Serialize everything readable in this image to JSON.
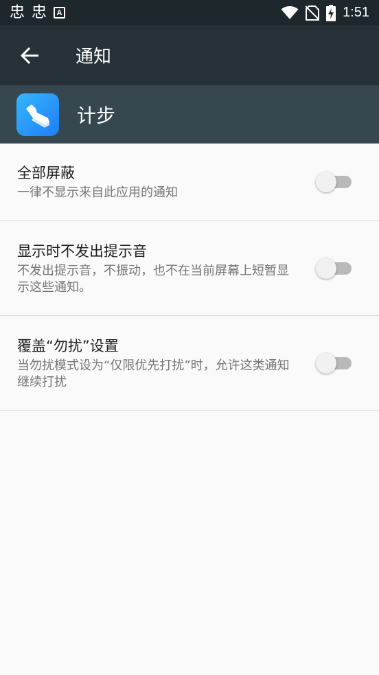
{
  "status_bar": {
    "time": "1:51",
    "left_glyphs": [
      "忠",
      "忠"
    ],
    "notification_badge": "A",
    "icons": [
      "wifi-icon",
      "no-sim-icon",
      "battery-charging-icon"
    ]
  },
  "toolbar": {
    "title": "通知",
    "back_icon": "arrow-back-icon"
  },
  "app": {
    "name": "计步",
    "icon": "shoe-icon",
    "icon_colors": [
      "#35b6ff",
      "#1f7ef5"
    ]
  },
  "settings": [
    {
      "title": "全部屏蔽",
      "description": "一律不显示来自此应用的通知",
      "enabled": false
    },
    {
      "title": "显示时不发出提示音",
      "description": "不发出提示音，不振动，也不在当前屏幕上短暂显示这些通知。",
      "enabled": false
    },
    {
      "title": "覆盖“勿扰”设置",
      "description": "当勿扰模式设为“仅限优先打扰”时，允许这类通知继续打扰",
      "enabled": false
    }
  ],
  "colors": {
    "status_bar": "#1e272c",
    "toolbar": "#263238",
    "app_header": "#37474f",
    "background": "#fafafa"
  }
}
